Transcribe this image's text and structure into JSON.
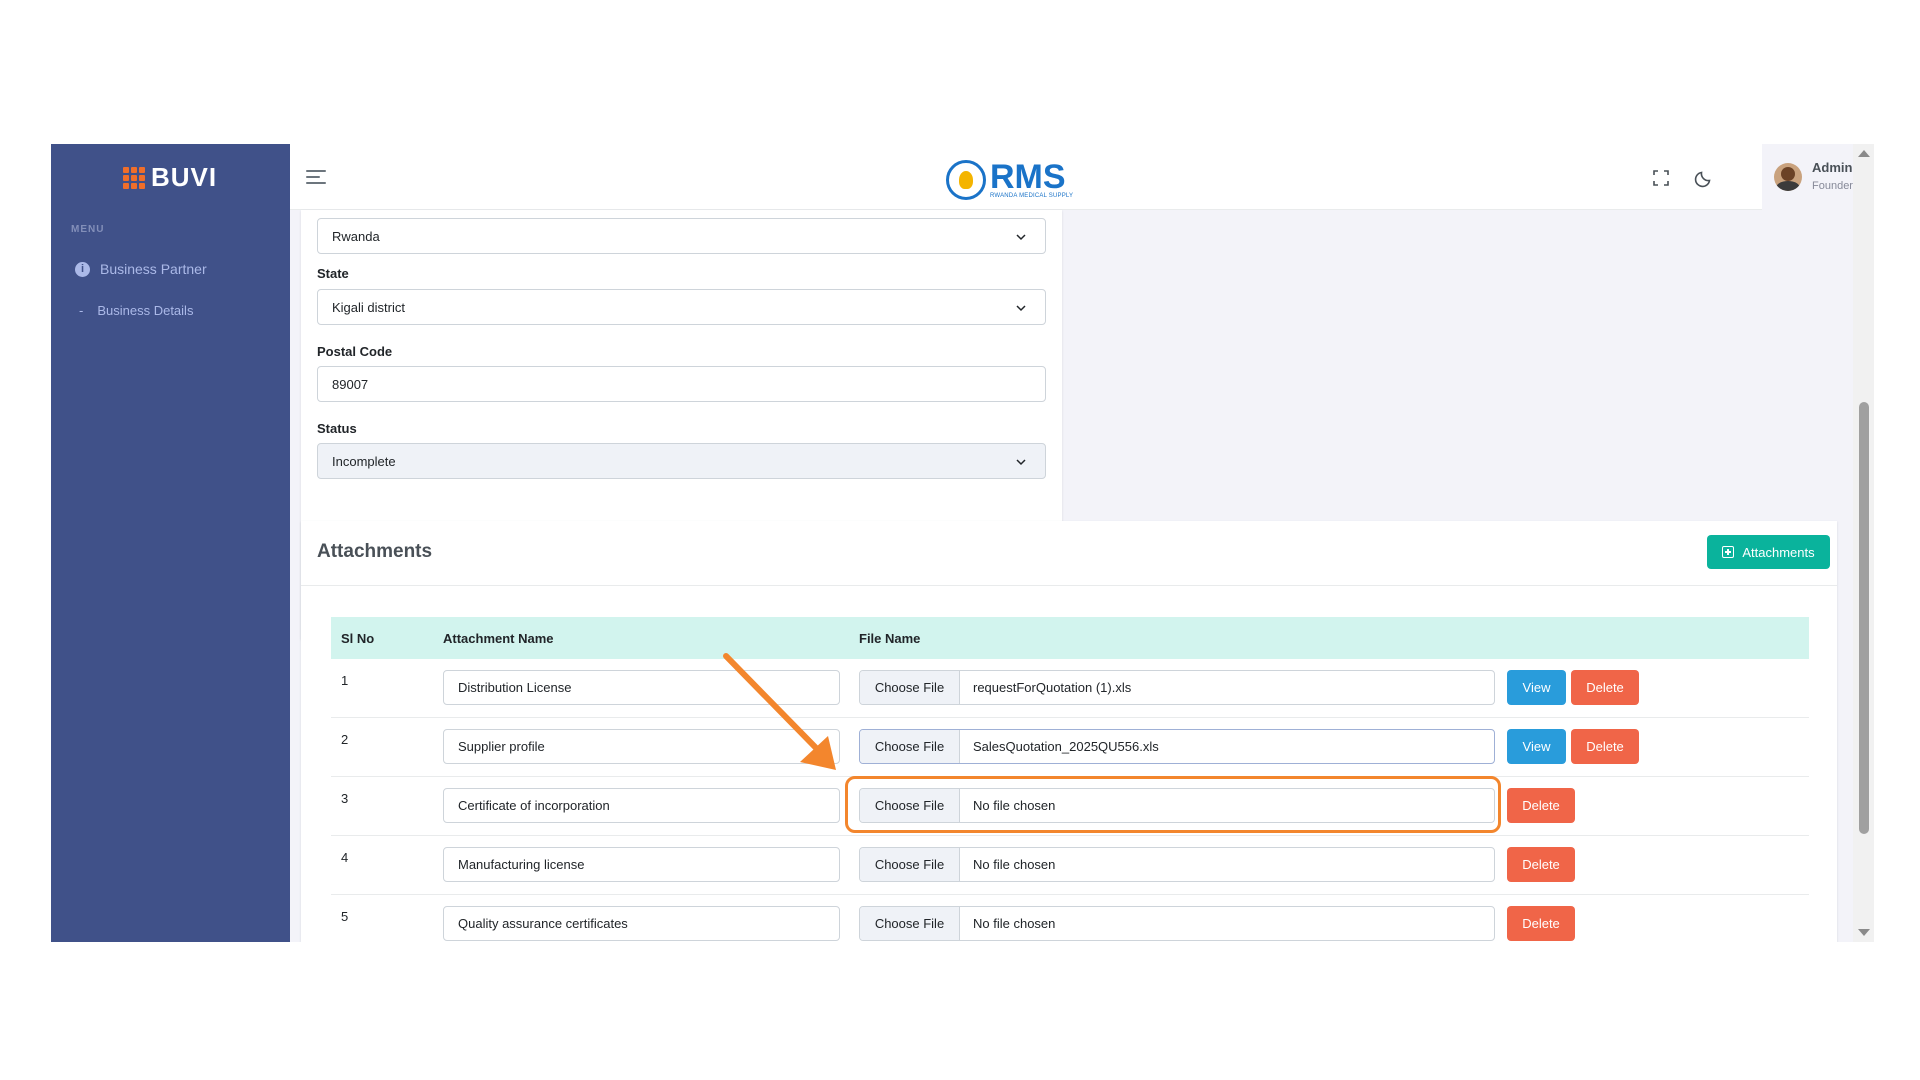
{
  "sidebar": {
    "logo_text": "BUVI",
    "menu_title": "MENU",
    "nav_item": "Business Partner",
    "nav_sub": "Business Details",
    "nav_sub_bullet": "-",
    "info_glyph": "i"
  },
  "header": {
    "brand": "RMS",
    "brand_sub": "RWANDA MEDICAL SUPPLY",
    "user_name": "Admin",
    "user_role": "Founder"
  },
  "form": {
    "country_value": "Rwanda",
    "state_label": "State",
    "state_value": "Kigali district",
    "postal_label": "Postal Code",
    "postal_value": "89007",
    "status_label": "Status",
    "status_value": "Incomplete"
  },
  "attachments": {
    "title": "Attachments",
    "add_button_label": "Attachments",
    "columns": {
      "sl": "Sl No",
      "name": "Attachment Name",
      "file": "File Name"
    },
    "choose_label": "Choose File",
    "view_label": "View",
    "delete_label": "Delete",
    "rows": [
      {
        "sl": "1",
        "name": "Distribution License",
        "file": "requestForQuotation (1).xls"
      },
      {
        "sl": "2",
        "name": "Supplier profile",
        "file": "SalesQuotation_2025QU556.xls"
      },
      {
        "sl": "3",
        "name": "Certificate of incorporation",
        "file": "No file chosen"
      },
      {
        "sl": "4",
        "name": "Manufacturing license",
        "file": "No file chosen"
      },
      {
        "sl": "5",
        "name": "Quality assurance certificates",
        "file": "No file chosen"
      }
    ]
  },
  "colors": {
    "sidebar": "#405189",
    "accent_success": "#0ab39c",
    "info": "#299cdb",
    "danger": "#f06548",
    "annotation": "#f3862d",
    "table_header": "#d2f4ee"
  },
  "icons": [
    "menu-icon",
    "fullscreen-icon",
    "moon-icon",
    "info-icon",
    "chevron-down-icon",
    "plus-square-icon",
    "avatar"
  ]
}
